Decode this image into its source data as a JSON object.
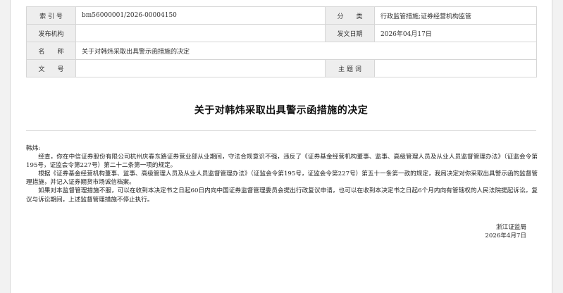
{
  "meta": {
    "index_label": "索 引 号",
    "index_value": "bm56000001/2026-00004150",
    "category_label": "分　　类",
    "category_value": "行政监管措施;证券经营机构监管",
    "issuer_label": "发布机构",
    "issuer_value": "",
    "date_label": "发文日期",
    "date_value": "2026年04月17日",
    "name_label": "名　　称",
    "name_value": "关于对韩炜采取出具警示函措施的决定",
    "docno_label": "文　　号",
    "docno_value": "",
    "subject_label": "主 题 词",
    "subject_value": ""
  },
  "document": {
    "title": "关于对韩炜采取出具警示函措施的决定",
    "addressee": "韩炜:",
    "paragraphs": [
      "经查，你在中信证券股份有限公司杭州庆春东路证券营业部从业期间，守法合规意识不强，违反了《证券基金经营机构董事、监事、高级管理人员及从业人员监督管理办法》（证监会令第195号，证监会令第227号）第二十二条第一项的规定。",
      "根据《证券基金经营机构董事、监事、高级管理人员及从业人员监督管理办法》（证监会令第195号，证监会令第227号）第五十一条第一款的规定，我局决定对你采取出具警示函的监督管理措施，并记入证券期货市场诚信档案。",
      "如果对本监督管理措施不服，可以在收到本决定书之日起60日内向中国证券监督管理委员会提出行政复议申请，也可以在收到本决定书之日起6个月内向有管辖权的人民法院提起诉讼。复议与诉讼期间，上述监督管理措施不停止执行。"
    ],
    "signer": "浙江证监局",
    "sign_date": "2026年4月7日"
  }
}
